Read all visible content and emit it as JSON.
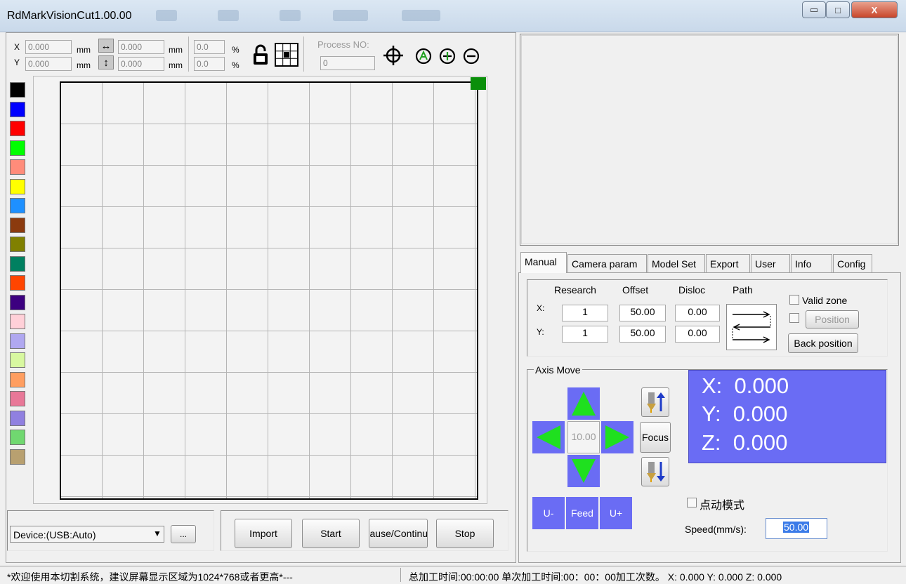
{
  "window": {
    "title": "RdMarkVisionCut1.00.00",
    "buttons": {
      "minimize": "▭",
      "maximize": "□",
      "close": "X"
    }
  },
  "toolbar": {
    "x_label": "X",
    "y_label": "Y",
    "x_value": "0.000",
    "y_value": "0.000",
    "unit_mm": "mm",
    "width_value": "0.000",
    "height_value": "0.000",
    "scale_x_value": "0.0",
    "scale_y_value": "0.0",
    "percent": "%",
    "process_no_label": "Process NO:",
    "process_no_value": "0"
  },
  "palette": {
    "colors": [
      "#000000",
      "#0000ff",
      "#ff0000",
      "#00ff00",
      "#ff8c7a",
      "#ffff00",
      "#1e90ff",
      "#8b3a0e",
      "#808000",
      "#008060",
      "#ff4500",
      "#3c0080",
      "#ffd0d8",
      "#b0a8f0",
      "#d8f8a0",
      "#ff9e60",
      "#e87898",
      "#9080e0",
      "#70d870",
      "#b8a070"
    ]
  },
  "right_tabs": [
    "Manual",
    "Camera param",
    "Model Set",
    "Export",
    "User",
    "Info",
    "Config"
  ],
  "manual": {
    "col_research": "Research",
    "col_offset": "Offset",
    "col_disloc": "Disloc",
    "col_path": "Path",
    "row_x": "X:",
    "row_y": "Y:",
    "x_research": "1",
    "y_research": "1",
    "x_offset": "50.00",
    "y_offset": "50.00",
    "x_disloc": "0.00",
    "y_disloc": "0.00",
    "valid_zone": "Valid zone",
    "position": "Position",
    "back_position": "Back position"
  },
  "axis": {
    "group_label": "Axis Move",
    "step_value": "10.00",
    "focus": "Focus",
    "x_readout": "X:  0.000",
    "y_readout": "Y:  0.000",
    "z_readout": "Z:  0.000",
    "u_minus": "U-",
    "feed": "Feed",
    "u_plus": "U+",
    "jog_mode": "点动模式",
    "speed_label": "Speed(mm/s):",
    "speed_value": "50.00"
  },
  "bottom": {
    "device": "Device:(USB:Auto)",
    "more": "...",
    "import": "Import",
    "start": "Start",
    "pause": "Pause/Continue",
    "stop": "Stop"
  },
  "status": {
    "left": "*欢迎使用本切割系统，建议屏幕显示区域为1024*768或者更高*---",
    "right": "总加工时间:00:00:00 单次加工时间:00：00：00加工次数。 X: 0.000  Y: 0.000  Z: 0.000"
  },
  "colors": {
    "readout_bg": "#6a6cf4",
    "arrow_green": "#1fe01f",
    "marker_green": "#0a8f0a"
  }
}
